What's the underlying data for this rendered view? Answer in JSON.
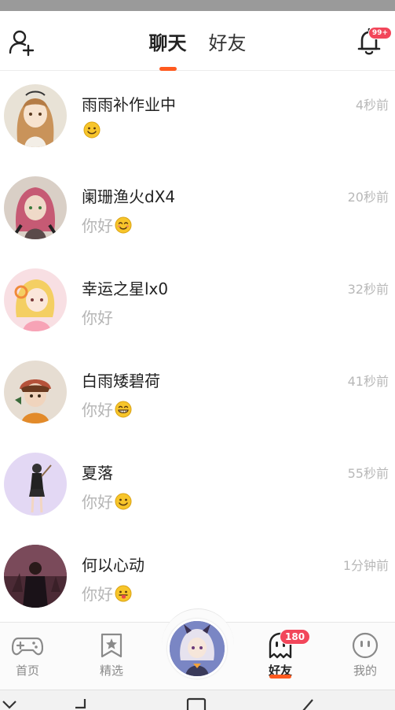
{
  "header": {
    "tabs": [
      {
        "label": "聊天",
        "active": true
      },
      {
        "label": "好友",
        "active": false
      }
    ],
    "notification_badge": "99+"
  },
  "chats": [
    {
      "name": "雨雨补作业中",
      "time": "4秒前",
      "message": "",
      "emoji": "smile-emoji",
      "avatar_bg": "#e8e2d6"
    },
    {
      "name": "阑珊渔火dX4",
      "time": "20秒前",
      "message": "你好",
      "emoji": "blush-emoji",
      "avatar_bg": "#d9cfc6"
    },
    {
      "name": "幸运之星lx0",
      "time": "32秒前",
      "message": "你好",
      "emoji": "",
      "avatar_bg": "#f8dfe3"
    },
    {
      "name": "白雨矮碧荷",
      "time": "41秒前",
      "message": "你好",
      "emoji": "grin-emoji",
      "avatar_bg": "#e6ddd2"
    },
    {
      "name": "夏落",
      "time": "55秒前",
      "message": "你好",
      "emoji": "smile-emoji",
      "avatar_bg": "#e3d8f4"
    },
    {
      "name": "何以心动",
      "time": "1分钟前",
      "message": "你好",
      "emoji": "tongue-emoji",
      "avatar_bg": "#4b2a35"
    }
  ],
  "bottom_nav": {
    "items": [
      {
        "label": "首页",
        "icon": "gamepad-icon"
      },
      {
        "label": "精选",
        "icon": "star-bookmark-icon"
      },
      {
        "label": "好友",
        "icon": "ghost-icon",
        "badge": "180",
        "active": true
      },
      {
        "label": "我的",
        "icon": "face-icon"
      }
    ]
  },
  "colors": {
    "accent": "#ff5a1f",
    "badge": "#f2465a",
    "emoji": "#f7c52a"
  }
}
